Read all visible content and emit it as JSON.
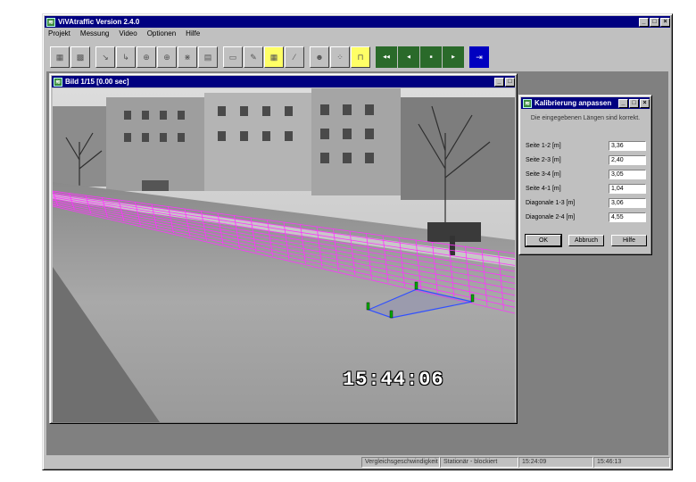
{
  "main_window": {
    "title": "ViVAtraffic Version 2.4.0",
    "controls": [
      "_",
      "□",
      "×"
    ],
    "menu": [
      "Projekt",
      "Messung",
      "Video",
      "Optionen",
      "Hilfe"
    ],
    "toolbar_buttons": [
      {
        "name": "open-project-icon",
        "glyph": "▦"
      },
      {
        "name": "save-project-icon",
        "glyph": "▩"
      },
      {
        "name": "line-tool-icon",
        "glyph": "↘"
      },
      {
        "name": "curve-tool-icon",
        "glyph": "↳"
      },
      {
        "name": "measure-tool-icon",
        "glyph": "⊕"
      },
      {
        "name": "measure2-tool-icon",
        "glyph": "⊕"
      },
      {
        "name": "cross-tool-icon",
        "glyph": "⋇"
      },
      {
        "name": "table-icon",
        "glyph": "▤"
      },
      {
        "name": "video-display-icon",
        "glyph": "▭"
      },
      {
        "name": "calibrate-icon",
        "glyph": "✎"
      },
      {
        "name": "grid-icon",
        "glyph": "▦"
      },
      {
        "name": "road-icon",
        "glyph": "⁄"
      },
      {
        "name": "person-icon",
        "glyph": "☻"
      },
      {
        "name": "counter-icon",
        "glyph": "⁘"
      },
      {
        "name": "gate-icon",
        "glyph": "⊓"
      },
      {
        "name": "rewind-icon",
        "glyph": "◀◀"
      },
      {
        "name": "prev-frame-icon",
        "glyph": "◀"
      },
      {
        "name": "stop-icon",
        "glyph": "■"
      },
      {
        "name": "play-icon",
        "glyph": "▶"
      },
      {
        "name": "export-icon",
        "glyph": "⇥"
      }
    ],
    "status": [
      "Vergleichsgeschwindigkeit",
      "Stationär - blockiert",
      "15:24:09",
      "15:46:13"
    ]
  },
  "image_window": {
    "title": "Bild 1/15 [0.00 sec]",
    "controls": [
      "_",
      "□",
      "×"
    ],
    "timestamp": "15:44:06"
  },
  "calibration_dialog": {
    "title": "Kalibrierung anpassen",
    "controls": [
      "_",
      "□",
      "×"
    ],
    "hint": "Die eingegebenen Längen sind korrekt.",
    "fields": [
      {
        "label": "Seite 1-2 [m]",
        "value": "3,36"
      },
      {
        "label": "Seite 2-3 [m]",
        "value": "2,40"
      },
      {
        "label": "Seite 3-4 [m]",
        "value": "3,05"
      },
      {
        "label": "Seite 4-1 [m]",
        "value": "1,04"
      },
      {
        "label": "Diagonale 1-3 [m]",
        "value": "3,06"
      },
      {
        "label": "Diagonale 2-4 [m]",
        "value": "4,55"
      }
    ],
    "buttons": {
      "ok": "OK",
      "cancel": "Abbruch",
      "help": "Hilfe"
    }
  },
  "colors": {
    "titlebar": "#000080",
    "grid": "#ff33ff",
    "calibration_quad": "#3050ff"
  }
}
